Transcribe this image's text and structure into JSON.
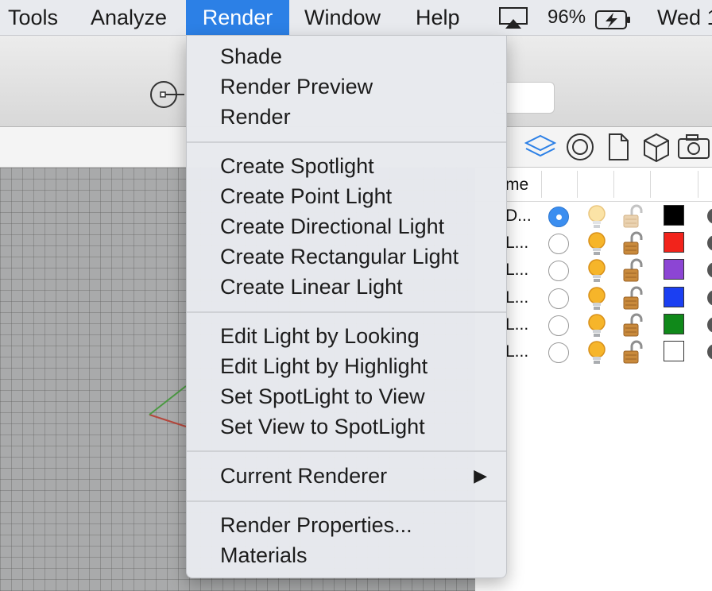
{
  "menubar": {
    "items": [
      "Tools",
      "Analyze",
      "Render",
      "Window",
      "Help"
    ],
    "active": "Render",
    "battery": "96%",
    "day": "Wed 1"
  },
  "render_menu": {
    "groups": [
      [
        "Shade",
        "Render Preview",
        "Render"
      ],
      [
        "Create Spotlight",
        "Create Point Light",
        "Create Directional Light",
        "Create Rectangular Light",
        "Create Linear Light"
      ],
      [
        "Edit Light by Looking",
        "Edit Light by Highlight",
        "Set SpotLight to View",
        "Set View to SpotLight"
      ],
      [
        "Current Renderer"
      ],
      [
        "Render Properties...",
        "Materials"
      ]
    ],
    "submenu_arrow": "▶"
  },
  "layers_panel": {
    "header_name": "me",
    "tab_icons": [
      "layers-icon",
      "target-icon",
      "document-icon",
      "cube-icon",
      "camera-icon"
    ],
    "rows": [
      {
        "name": "D...",
        "current": true,
        "light_on": false,
        "color": "#000000"
      },
      {
        "name": "L...",
        "current": false,
        "light_on": true,
        "color": "#f2231b"
      },
      {
        "name": "L...",
        "current": false,
        "light_on": true,
        "color": "#8c45d4"
      },
      {
        "name": "L...",
        "current": false,
        "light_on": true,
        "color": "#1b3ff2"
      },
      {
        "name": "L...",
        "current": false,
        "light_on": true,
        "color": "#10891a"
      },
      {
        "name": "L...",
        "current": false,
        "light_on": true,
        "color": "#ffffff"
      }
    ]
  },
  "colors": {
    "accent": "#2c80e6",
    "panel_icon_blue": "#2c80e6"
  }
}
